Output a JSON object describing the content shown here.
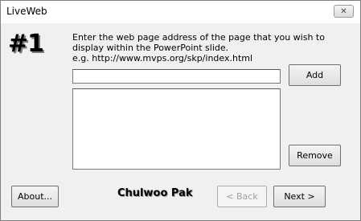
{
  "window": {
    "title": "LiveWeb",
    "close_label": "✕"
  },
  "step": {
    "label": "#1"
  },
  "instructions": {
    "line1": "Enter the web page address of the page that you wish to",
    "line2": "display within the PowerPoint slide.",
    "line3": "e.g. http://www.mvps.org/skp/index.html"
  },
  "url_input": {
    "value": ""
  },
  "buttons": {
    "add": "Add",
    "remove": "Remove",
    "about": "About...",
    "back": "< Back",
    "next": "Next >"
  },
  "author": {
    "name": "Chulwoo Pak"
  }
}
